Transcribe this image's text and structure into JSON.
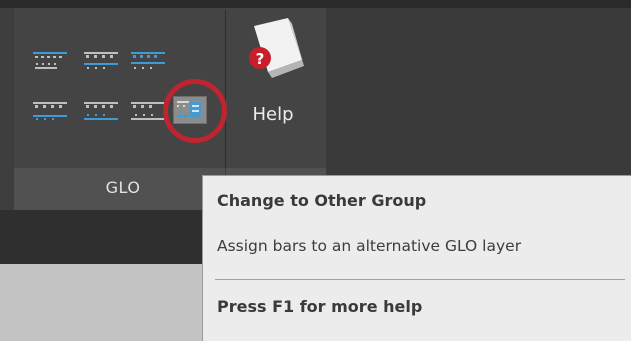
{
  "ribbon": {
    "group_label": "GLO",
    "help_button": {
      "label": "Help",
      "icon": "help-book-icon"
    },
    "tools": [
      {
        "name": "glo-tool-1-icon"
      },
      {
        "name": "glo-tool-2-icon"
      },
      {
        "name": "glo-tool-3-icon"
      },
      {
        "name": "glo-tool-4-icon"
      },
      {
        "name": "glo-tool-5-icon"
      },
      {
        "name": "glo-tool-6-icon"
      },
      {
        "name": "change-to-other-group-icon",
        "highlighted": true
      }
    ]
  },
  "tooltip": {
    "title": "Change to Other Group",
    "description": "Assign bars to an alternative GLO layer",
    "help_hint": "Press F1 for more help"
  },
  "colors": {
    "ribbon_dark": "#3a3a3a",
    "group_bg": "#444444",
    "highlight_ring": "#c02430",
    "icon_blue": "#3f9bd8",
    "tooltip_bg": "#ececec",
    "help_red": "#c8202a"
  }
}
